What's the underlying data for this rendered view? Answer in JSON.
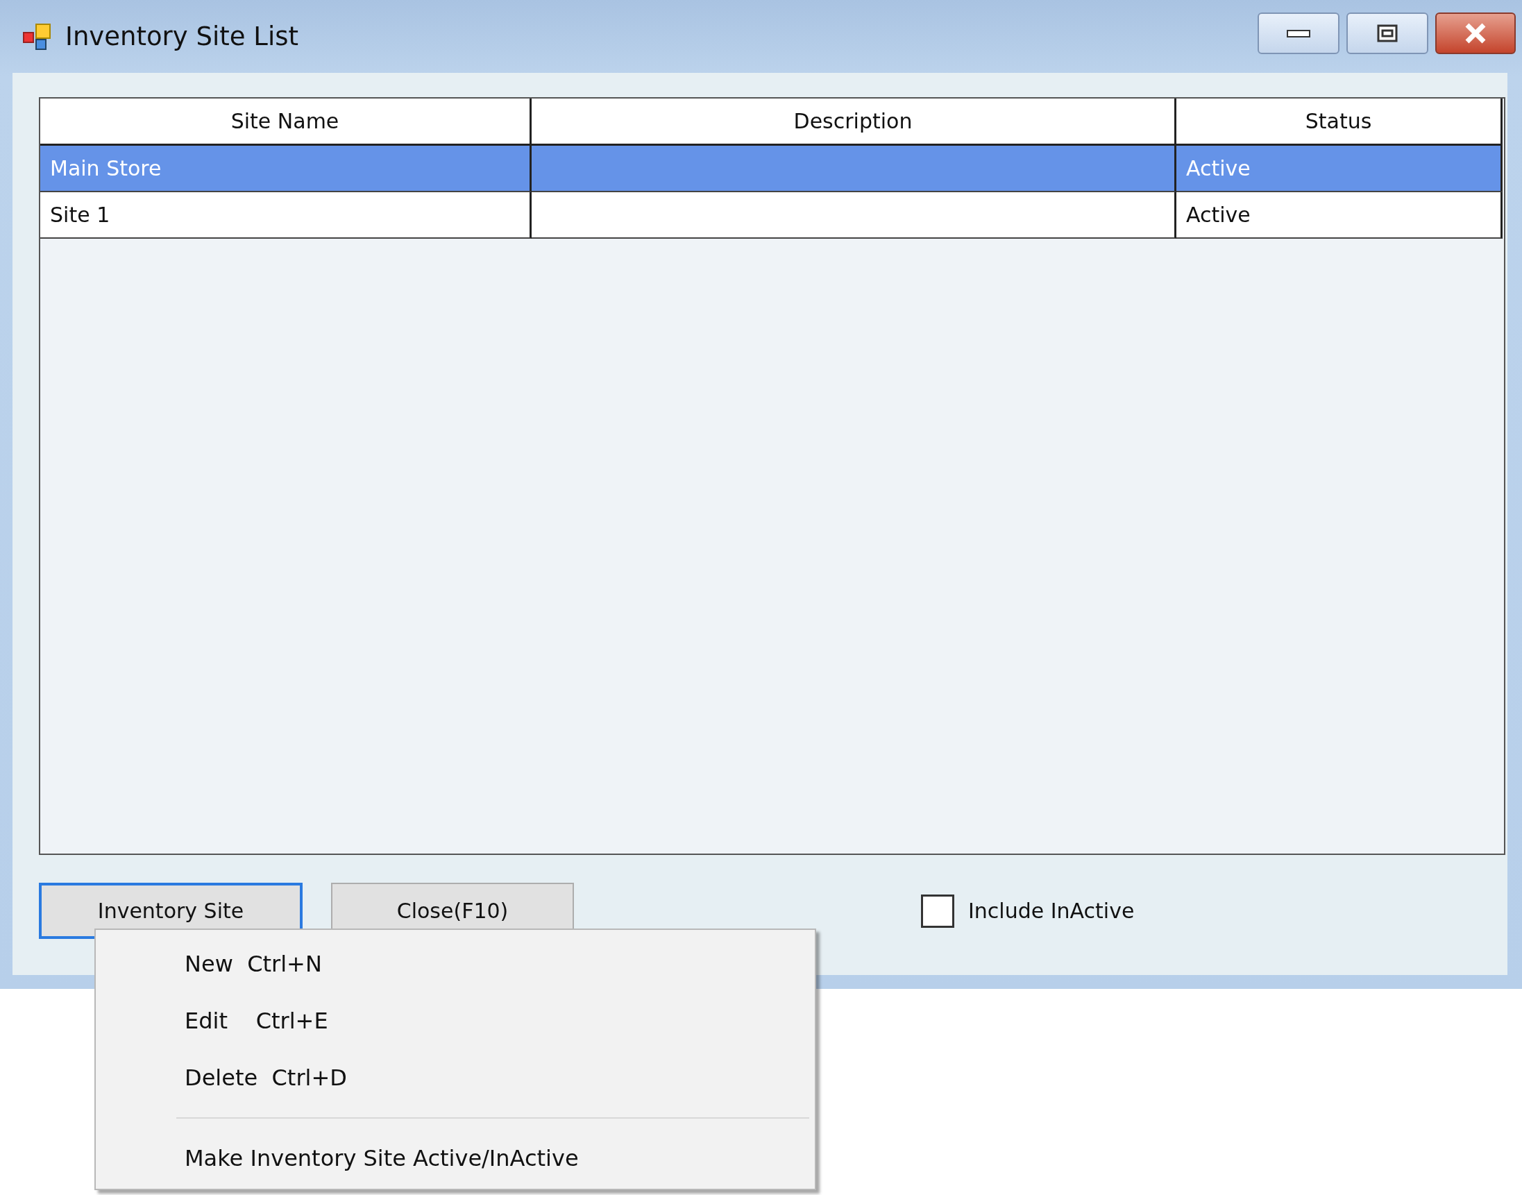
{
  "window": {
    "title": "Inventory Site List"
  },
  "table": {
    "columns": [
      "Site Name",
      "Description",
      "Status"
    ],
    "rows": [
      {
        "site_name": "Main Store",
        "status": "Active",
        "selected": true
      },
      {
        "site_name": "Site 1",
        "status": "Active",
        "selected": false
      }
    ]
  },
  "buttons": [
    {
      "label": "Inventory Site",
      "focused": true
    },
    {
      "label": "Close(F10)",
      "focused": false
    }
  ],
  "include_inactive": {
    "label": "Include InActive",
    "checked": false
  },
  "context_menu": {
    "items": [
      {
        "kind": "item",
        "label": "New  Ctrl+N"
      },
      {
        "kind": "item",
        "label": "Edit    Ctrl+E"
      },
      {
        "kind": "item",
        "label": "Delete  Ctrl+D"
      },
      {
        "kind": "separator"
      },
      {
        "kind": "item",
        "label": "Make Inventory Site Active/InActive"
      }
    ]
  }
}
